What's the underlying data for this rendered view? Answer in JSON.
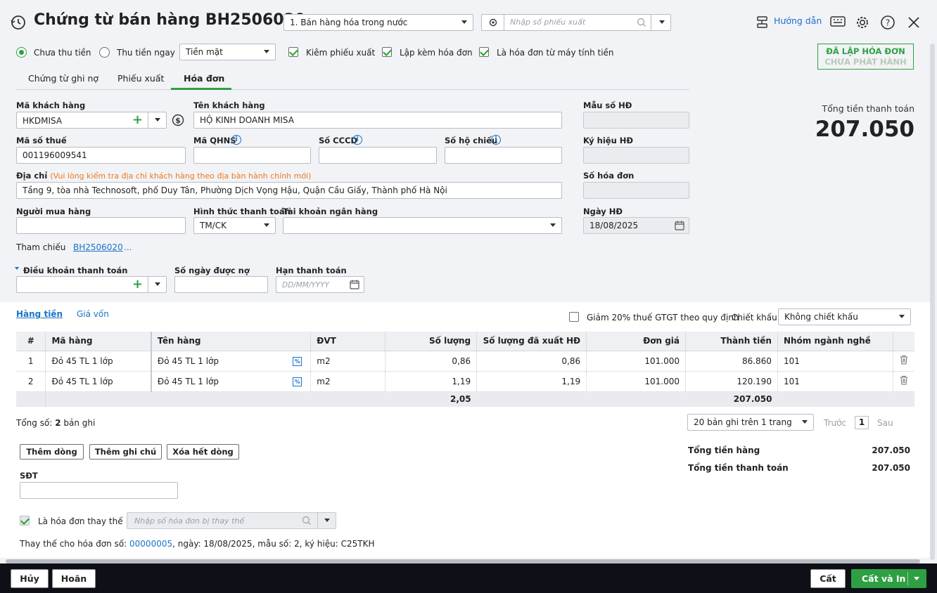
{
  "header": {
    "title": "Chứng từ bán hàng BH2506020",
    "type_select": "1. Bán hàng hóa trong nước",
    "search_placeholder": "Nhập số phiếu xuất",
    "help_label": "Hướng dẫn"
  },
  "options": {
    "unpaid_label": "Chưa thu tiền",
    "paid_label": "Thu tiền ngay",
    "payment_method": "Tiền mặt",
    "cb_export_label": "Kiêm phiếu xuất",
    "cb_invoice_label": "Lập kèm hóa đơn",
    "cb_cashreg_label": "Là hóa đơn từ máy tính tiền"
  },
  "status": {
    "line1": "ĐÃ LẬP HÓA ĐƠN",
    "line2": "CHƯA PHÁT HÀNH"
  },
  "tabs": [
    "Chứng từ ghi nợ",
    "Phiếu xuất",
    "Hóa đơn"
  ],
  "form": {
    "customer_code_label": "Mã khách hàng",
    "customer_code": "HKDMISA",
    "customer_name_label": "Tên khách hàng",
    "customer_name": "HỘ KINH DOANH MISA",
    "tax_code_label": "Mã số thuế",
    "tax_code": "001196009541",
    "qhns_label": "Mã QHNS",
    "cccd_label": "Số CCCD",
    "passport_label": "Số hộ chiếu",
    "address_label": "Địa chỉ",
    "address_note": "(Vui lòng kiểm tra địa chỉ khách hàng theo địa bàn hành chính mới)",
    "address": "Tầng 9, tòa nhà Technosoft, phố Duy Tân, Phường Dịch Vọng Hậu, Quận Cầu Giấy, Thành phố Hà Nội",
    "buyer_label": "Người mua hàng",
    "pay_form_label": "Hình thức thanh toán",
    "pay_form": "TM/CK",
    "bank_label": "Tài khoản ngân hàng",
    "ref_label": "Tham chiếu",
    "ref_value": "BH2506020",
    "ref_more": "...",
    "terms_label": "Điều khoản thanh toán",
    "days_label": "Số ngày được nợ",
    "due_label": "Hạn thanh toán",
    "due_placeholder": "DD/MM/YYYY"
  },
  "invoice": {
    "template_label": "Mẫu số HĐ",
    "symbol_label": "Ký hiệu HĐ",
    "number_label": "Số hóa đơn",
    "date_label": "Ngày HĐ",
    "date": "18/08/2025"
  },
  "total_box": {
    "label": "Tổng tiền thanh toán",
    "value": "207.050"
  },
  "lines": {
    "tab_goods": "Hàng tiền",
    "tab_cost": "Giá vốn",
    "vat_reduce_label": "Giảm 20% thuế GTGT theo quy định",
    "discount_label": "Chiết khấu",
    "discount_value": "Không chiết khấu",
    "columns": [
      "#",
      "Mã hàng",
      "Tên hàng",
      "ĐVT",
      "Số lượng",
      "Số lượng đã xuất HĐ",
      "Đơn giá",
      "Thành tiền",
      "Nhóm ngành nghề"
    ],
    "rows": [
      {
        "no": "1",
        "code": "Đỏ 45 TL 1 lớp",
        "name": "Đỏ 45 TL 1 lớp",
        "unit": "m2",
        "qty": "0,86",
        "qty_inv": "0,86",
        "price": "101.000",
        "amount": "86.860",
        "group": "101"
      },
      {
        "no": "2",
        "code": "Đỏ 45 TL 1 lớp",
        "name": "Đỏ 45 TL 1 lớp",
        "unit": "m2",
        "qty": "1,19",
        "qty_inv": "1,19",
        "price": "101.000",
        "amount": "120.190",
        "group": "101"
      }
    ],
    "total_qty": "2,05",
    "total_amount": "207.050",
    "record_count_prefix": "Tổng số:",
    "record_count": "2",
    "record_count_suffix": "bản ghi",
    "page_size": "20 bản ghi trên 1 trang",
    "prev": "Trước",
    "page": "1",
    "next": "Sau"
  },
  "actions": {
    "add_row": "Thêm dòng",
    "add_note": "Thêm ghi chú",
    "clear_rows": "Xóa hết dòng"
  },
  "summary": {
    "goods_label": "Tổng tiền hàng",
    "goods_value": "207.050",
    "pay_label": "Tổng tiền thanh toán",
    "pay_value": "207.050"
  },
  "bottom": {
    "phone_label": "SĐT",
    "replace_label": "Là hóa đơn thay thế",
    "replace_placeholder": "Nhập số hóa đơn bị thay thế",
    "replace_info_prefix": "Thay thế cho hóa đơn số:",
    "replace_number": "00000005",
    "replace_info_rest": ", ngày:  18/08/2025, mẫu số:  2, ký hiệu:  C25TKH"
  },
  "footer": {
    "cancel": "Hủy",
    "undo": "Hoãn",
    "save": "Cất",
    "save_print": "Cất và In"
  },
  "colors": {
    "accent_green": "#2ea043",
    "link_blue": "#1a73c9",
    "footer_bg": "#0d1117"
  }
}
